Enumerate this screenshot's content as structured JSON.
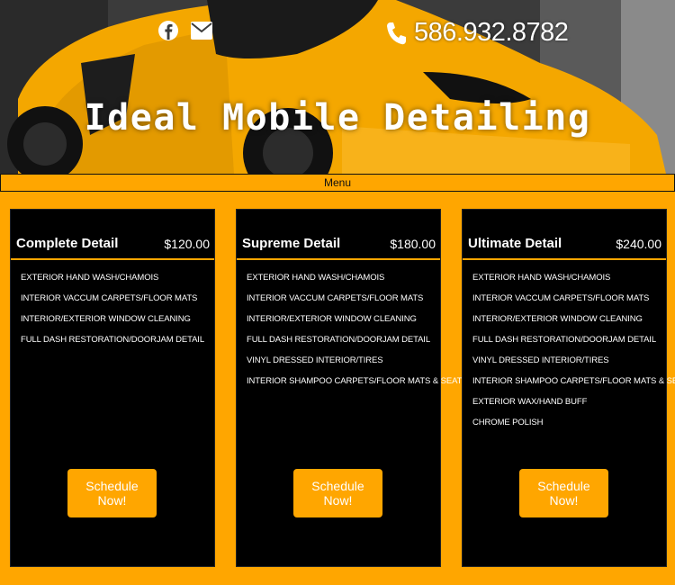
{
  "header": {
    "phone_number": "586.932.8782",
    "site_title": "Ideal Mobile Detailing",
    "social_icons": [
      "facebook-icon",
      "mail-icon"
    ],
    "phone_icon": "phone-icon"
  },
  "nav": {
    "menu_label": "Menu"
  },
  "colors": {
    "accent": "#ffa600",
    "card_bg": "#000000",
    "text": "#ffffff"
  },
  "packages": [
    {
      "title": "Complete Detail",
      "price": "$120.00",
      "features": [
        "EXTERIOR HAND WASH/CHAMOIS",
        "INTERIOR VACCUM CARPETS/FLOOR MATS",
        "INTERIOR/EXTERIOR WINDOW CLEANING",
        "FULL DASH RESTORATION/DOORJAM DETAIL"
      ],
      "button_label": "Schedule Now!"
    },
    {
      "title": "Supreme Detail",
      "price": "$180.00",
      "features": [
        "EXTERIOR HAND WASH/CHAMOIS",
        "INTERIOR VACCUM CARPETS/FLOOR MATS",
        "INTERIOR/EXTERIOR WINDOW CLEANING",
        "FULL DASH RESTORATION/DOORJAM DETAIL",
        "VINYL DRESSED INTERIOR/TIRES",
        "INTERIOR SHAMPOO CARPETS/FLOOR MATS & SEATS"
      ],
      "button_label": "Schedule Now!"
    },
    {
      "title": "Ultimate Detail",
      "price": "$240.00",
      "features": [
        "EXTERIOR HAND WASH/CHAMOIS",
        "INTERIOR VACCUM CARPETS/FLOOR MATS",
        "INTERIOR/EXTERIOR WINDOW CLEANING",
        "FULL DASH RESTORATION/DOORJAM DETAIL",
        "VINYL DRESSED INTERIOR/TIRES",
        "INTERIOR SHAMPOO CARPETS/FLOOR MATS & SEATS",
        "EXTERIOR WAX/HAND BUFF",
        "CHROME POLISH"
      ],
      "button_label": "Schedule Now!"
    }
  ]
}
